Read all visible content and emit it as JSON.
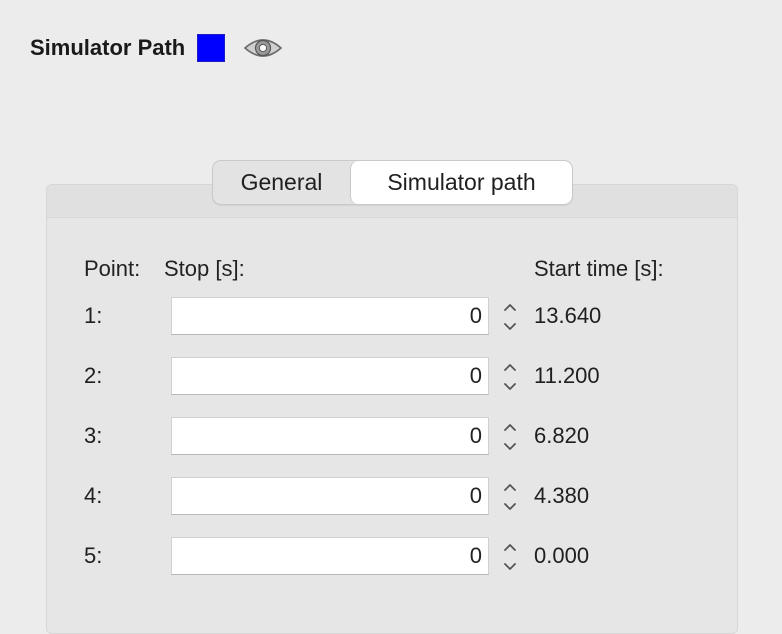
{
  "header": {
    "title": "Simulator Path",
    "path_color": "#0000ff",
    "eye_icon": "eye-icon"
  },
  "tabs": [
    {
      "label": "General",
      "selected": false
    },
    {
      "label": "Simulator path",
      "selected": true
    }
  ],
  "table": {
    "point_header": "Point:",
    "stop_header": "Stop [s]:",
    "start_header": "Start time [s]:",
    "rows": [
      {
        "point": "1:",
        "stop": "0",
        "start": "13.640"
      },
      {
        "point": "2:",
        "stop": "0",
        "start": "11.200"
      },
      {
        "point": "3:",
        "stop": "0",
        "start": "6.820"
      },
      {
        "point": "4:",
        "stop": "0",
        "start": "4.380"
      },
      {
        "point": "5:",
        "stop": "0",
        "start": "0.000"
      }
    ]
  }
}
